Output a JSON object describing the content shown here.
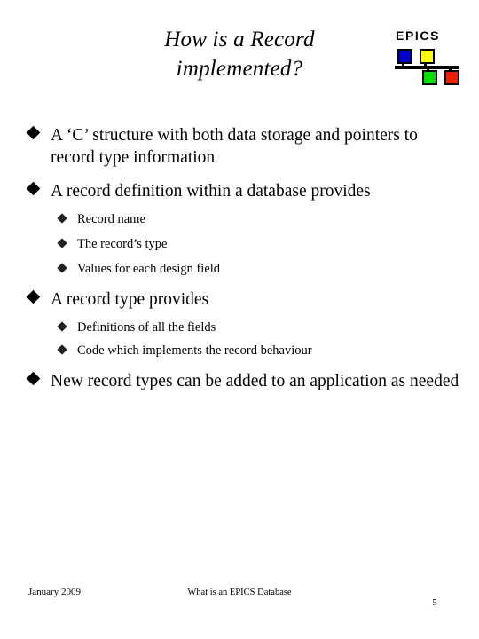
{
  "slide": {
    "title_lines": [
      "How is a Record",
      "implemented?"
    ],
    "logo": {
      "wordmark": "EPICS",
      "node_blue_color": "#0000cc",
      "node_yellow_color": "#ffff00",
      "node_green_color": "#00dd00",
      "node_red_color": "#ee2200"
    },
    "bullets": [
      {
        "level": 1,
        "text": "A ‘C’ structure with both data storage and pointers to record type information"
      },
      {
        "level": 1,
        "text": "A record definition within a database provides"
      },
      {
        "level": 2,
        "text": "Record name"
      },
      {
        "level": 2,
        "text": "The record’s type"
      },
      {
        "level": 2,
        "text": "Values for each design field"
      },
      {
        "level": 1,
        "text": "A record type provides"
      },
      {
        "level": 2,
        "text": "Definitions of all the fields"
      },
      {
        "level": 2,
        "text": "Code which implements the record behaviour"
      },
      {
        "level": 1,
        "text": "New record types can be added to an application as needed"
      }
    ],
    "footer": {
      "date": "January 2009",
      "center": "What is an EPICS Database",
      "page_number": "5"
    }
  }
}
